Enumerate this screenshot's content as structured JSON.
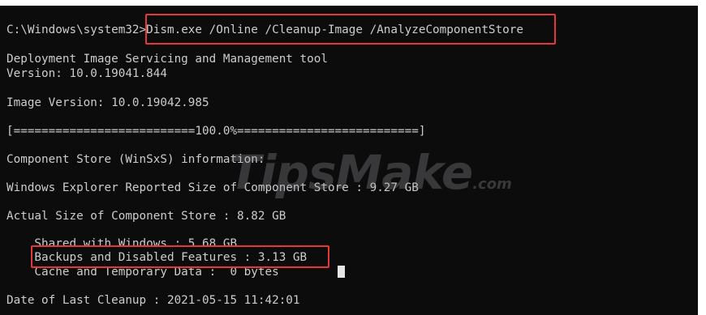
{
  "terminal": {
    "lines": {
      "prompt": "C:\\Windows\\system32>",
      "command": "Dism.exe /Online /Cleanup-Image /AnalyzeComponentStore",
      "tool_name": "Deployment Image Servicing and Management tool",
      "tool_version": "Version: 10.0.19041.844",
      "image_version": "Image Version: 10.0.19042.985",
      "progress": "[==========================100.0%==========================]",
      "component_store_info": "Component Store (WinSxS) information:",
      "explorer_size": "Windows Explorer Reported Size of Component Store : 9.27 GB",
      "actual_size": "Actual Size of Component Store : 8.82 GB",
      "shared_with_windows": "    Shared with Windows : 5.68 GB",
      "backups_disabled": "    Backups and Disabled Features : 3.13 GB",
      "cache_temp": "    Cache and Temporary Data :  0 bytes",
      "last_cleanup": "Date of Last Cleanup : 2021-05-15 11:42:01"
    },
    "progress_percent": 100.0
  },
  "watermark": {
    "brand": "TipsMake",
    "suffix": ".com"
  },
  "colors": {
    "console_bg": "#0c0c0c",
    "console_text": "#cccccc",
    "highlight_border": "#e5383b",
    "page_bg": "#ffffff"
  }
}
